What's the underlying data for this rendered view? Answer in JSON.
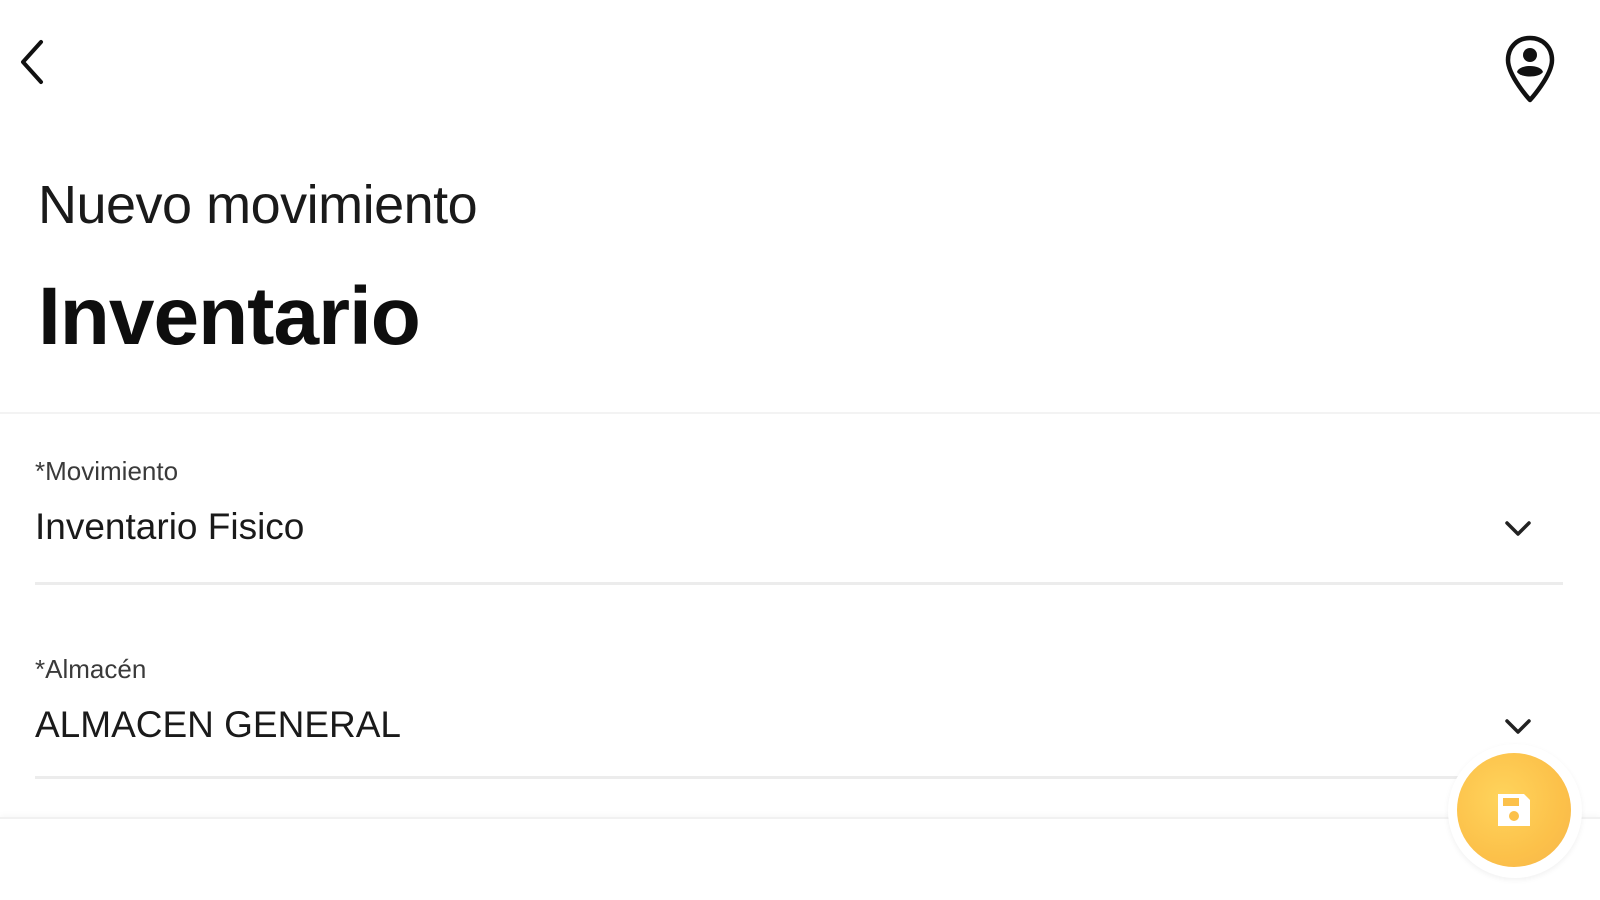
{
  "header": {
    "subtitle": "Nuevo movimiento",
    "title": "Inventario"
  },
  "topbar": {
    "back_icon": "chevron-left-icon",
    "location_icon": "person-location-pin-icon"
  },
  "form": {
    "fields": [
      {
        "label": "*Movimiento",
        "value": "Inventario Fisico",
        "icon": "chevron-down-icon"
      },
      {
        "label": "*Almacén",
        "value": "ALMACEN GENERAL",
        "icon": "chevron-down-icon"
      }
    ]
  },
  "fab": {
    "icon": "save-floppy-icon",
    "color": "#fcc14a"
  },
  "colors": {
    "background": "#ffffff",
    "divider": "#ececec",
    "accent": "#fcc14a"
  }
}
